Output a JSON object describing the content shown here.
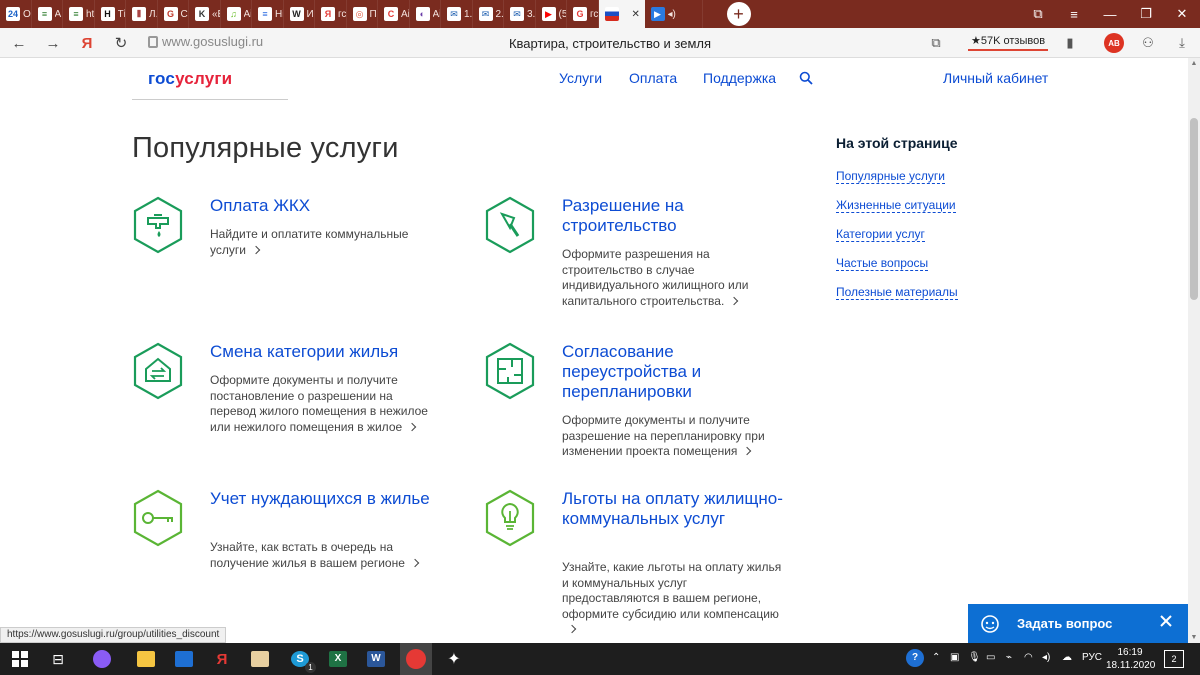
{
  "browser": {
    "tabs": [
      {
        "fav": "24",
        "label": "О",
        "color": "#1b62c8"
      },
      {
        "fav": "≡",
        "label": "А",
        "color": "#2a7a2a"
      },
      {
        "fav": "≡",
        "label": "ht",
        "color": "#2a7a2a"
      },
      {
        "fav": "H",
        "label": "Тi",
        "color": "#111111"
      },
      {
        "fav": "⦀",
        "label": "Л.",
        "color": "#9a2020"
      },
      {
        "fav": "G",
        "label": "Сi",
        "color": "#c0392b"
      },
      {
        "fav": "K",
        "label": "«Е",
        "color": "#333333"
      },
      {
        "fav": "♫",
        "label": "Ai",
        "color": "#6bbf2a"
      },
      {
        "fav": "≡",
        "label": "Нi",
        "color": "#2a6ae0"
      },
      {
        "fav": "W",
        "label": "Иi",
        "color": "#222222"
      },
      {
        "fav": "Я",
        "label": "гс",
        "color": "#e53935"
      },
      {
        "fav": "◎",
        "label": "Пi",
        "color": "#e2553a"
      },
      {
        "fav": "C",
        "label": "Аi",
        "color": "#e53935"
      },
      {
        "fav": "◐",
        "label": "Аi",
        "color": "#6a3da8"
      },
      {
        "fav": "✉",
        "label": "1.",
        "color": "#1e5fb0"
      },
      {
        "fav": "✉",
        "label": "2.",
        "color": "#1e5fb0"
      },
      {
        "fav": "✉",
        "label": "3.",
        "color": "#1e5fb0"
      },
      {
        "fav": "▶",
        "label": "(5",
        "color": "#ff0000"
      },
      {
        "fav": "G",
        "label": "гс",
        "color": "#e53935"
      }
    ],
    "active_tab_close": "✕",
    "new_tab": "+",
    "window_buttons": [
      "⧉",
      "≡",
      "—",
      "❐",
      "✕"
    ],
    "url": "www.gosuslugi.ru",
    "page_title": "Квартира, строительство и земля",
    "reviews": "★57K отзывов",
    "status_url": "https://www.gosuslugi.ru/group/utilities_discount"
  },
  "header": {
    "logo_part1": "гос",
    "logo_part2": "услуги",
    "nav": {
      "services": "Услуги",
      "payment": "Оплата",
      "support": "Поддержка",
      "cabinet": "Личный кабинет"
    }
  },
  "main": {
    "section_title": "Популярные услуги",
    "cards": [
      {
        "title": "Оплата ЖКХ",
        "desc": "Найдите и оплатите коммунальные услуги"
      },
      {
        "title": "Разрешение на строительство",
        "desc": "Оформите разрешения на строительство в случае индивидуального жилищного или капитального строительства."
      },
      {
        "title": "Смена категории жилья",
        "desc": "Оформите документы и получите постановление о разрешении на перевод жилого помещения в нежилое или нежилого помещения в жилое"
      },
      {
        "title": "Согласование переустройства и перепланировки",
        "desc": "Оформите документы и получите разрешение на перепланировку при изменении проекта помещения"
      },
      {
        "title": "Учет нуждающихся в жилье",
        "desc": "Узнайте, как встать в очередь на получение жилья в вашем регионе"
      },
      {
        "title": "Льготы на оплату жилищно-коммунальных услуг",
        "desc": "Узнайте, какие льготы на оплату жилья и коммунальных услуг предоставляются в вашем регионе, оформите субсидию или компенсацию"
      }
    ]
  },
  "sidebar": {
    "title": "На этой странице",
    "links": [
      "Популярные услуги",
      "Жизненные ситуации",
      "Категории услуг",
      "Частые вопросы",
      "Полезные материалы"
    ]
  },
  "help_widget": {
    "label": "Задать вопрос"
  },
  "taskbar": {
    "lang": "РУС",
    "time": "16:19",
    "date": "18.11.2020",
    "notifications": "2",
    "skype_badge": "1"
  },
  "colors": {
    "brand_blue": "#0d4cd3",
    "brand_red": "#e6233b",
    "icon_green": "#1a9c5a",
    "icon_lightgreen": "#5ab535",
    "help_blue": "#0d6fd3"
  }
}
